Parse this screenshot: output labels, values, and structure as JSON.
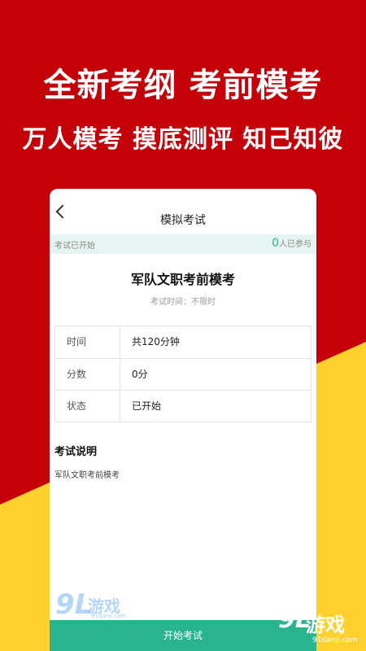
{
  "banner": {
    "headline_1": "全新考纲 考前模考",
    "headline_2": "万人模考 摸底测评 知己知彼"
  },
  "nav": {
    "title": "模拟考试"
  },
  "status": {
    "left": "考试已开始",
    "count": "0",
    "count_suffix": "人已参与"
  },
  "exam": {
    "title": "军队文职考前模考",
    "time_text": "考试时间：不限时"
  },
  "info_rows": [
    {
      "key": "时间",
      "value": "共120分钟"
    },
    {
      "key": "分数",
      "value": "0分"
    },
    {
      "key": "状态",
      "value": "已开始"
    }
  ],
  "description": {
    "title": "考试说明",
    "text": "军队文职考前模考"
  },
  "action": {
    "start_label": "开始考试"
  },
  "watermarks": {
    "mark": "9L",
    "name": "游戏",
    "url_left": "91danji.com",
    "url_right": "91danji.com"
  },
  "colors": {
    "background_red": "#c40009",
    "background_yellow": "#ffd12e",
    "accent_green": "#29b48e",
    "status_strip": "#e6f5f1"
  }
}
